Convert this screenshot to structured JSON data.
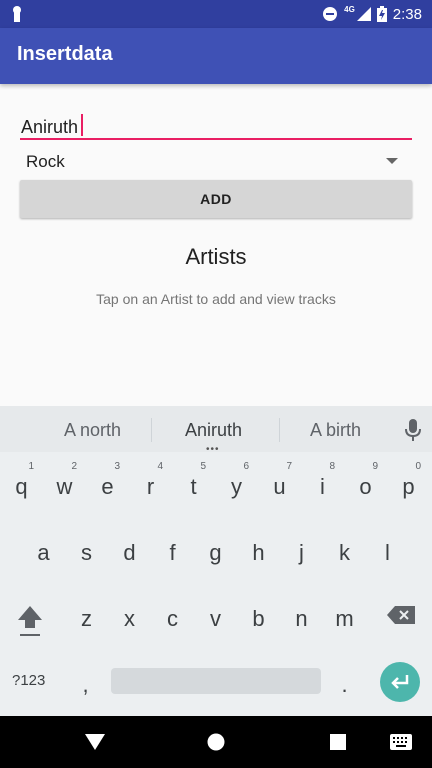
{
  "status_bar": {
    "time": "2:38",
    "network": "4G"
  },
  "app_bar": {
    "title": "Insertdata"
  },
  "form": {
    "name_value": "Aniruth",
    "genre_selected": "Rock",
    "add_label": "ADD"
  },
  "artists": {
    "heading": "Artists",
    "hint": "Tap on an Artist to add and view tracks"
  },
  "keyboard": {
    "suggestions": [
      "A north",
      "Aniruth",
      "A birth"
    ],
    "row1": [
      {
        "key": "q",
        "hint": "1"
      },
      {
        "key": "w",
        "hint": "2"
      },
      {
        "key": "e",
        "hint": "3"
      },
      {
        "key": "r",
        "hint": "4"
      },
      {
        "key": "t",
        "hint": "5"
      },
      {
        "key": "y",
        "hint": "6"
      },
      {
        "key": "u",
        "hint": "7"
      },
      {
        "key": "i",
        "hint": "8"
      },
      {
        "key": "o",
        "hint": "9"
      },
      {
        "key": "p",
        "hint": "0"
      }
    ],
    "row2": [
      "a",
      "s",
      "d",
      "f",
      "g",
      "h",
      "j",
      "k",
      "l"
    ],
    "row3": [
      "z",
      "x",
      "c",
      "v",
      "b",
      "n",
      "m"
    ],
    "symbols_label": "?123",
    "comma": ",",
    "period": "."
  },
  "colors": {
    "status_bar": "#303F9F",
    "app_bar": "#3F51B5",
    "accent": "#E91E63",
    "enter_key": "#4db6ac"
  }
}
